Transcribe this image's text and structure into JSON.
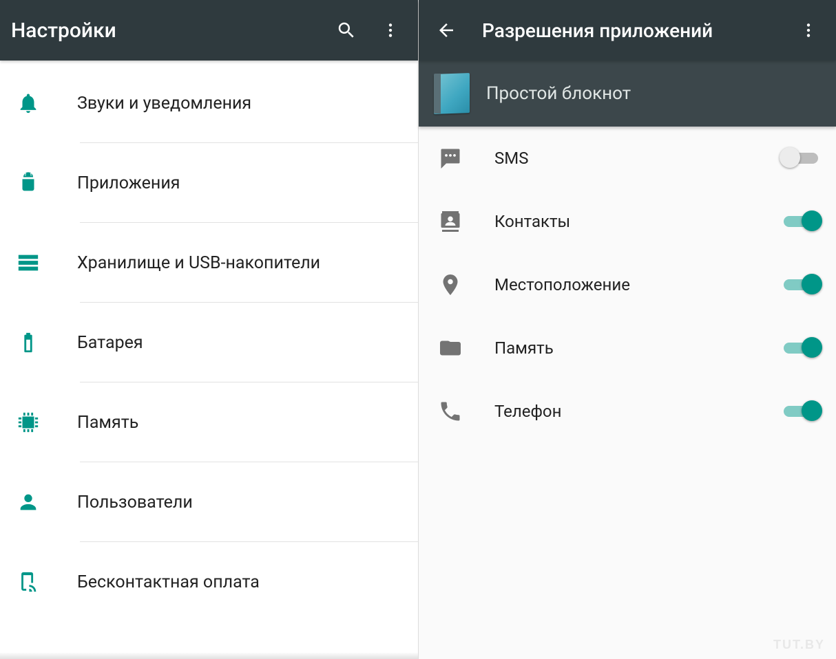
{
  "left": {
    "title": "Настройки",
    "items": [
      {
        "icon": "bell",
        "label": "Звуки и уведомления"
      },
      {
        "icon": "android",
        "label": "Приложения"
      },
      {
        "icon": "storage",
        "label": "Хранилище и USB-накопители"
      },
      {
        "icon": "battery",
        "label": "Батарея"
      },
      {
        "icon": "memory",
        "label": "Память"
      },
      {
        "icon": "user",
        "label": "Пользователи"
      },
      {
        "icon": "nfc",
        "label": "Бесконтактная оплата"
      }
    ]
  },
  "right": {
    "title": "Разрешения приложений",
    "app_name": "Простой блокнот",
    "permissions": [
      {
        "icon": "sms",
        "label": "SMS",
        "enabled": false
      },
      {
        "icon": "contacts",
        "label": "Контакты",
        "enabled": true
      },
      {
        "icon": "location",
        "label": "Местоположение",
        "enabled": true
      },
      {
        "icon": "folder",
        "label": "Память",
        "enabled": true
      },
      {
        "icon": "phone",
        "label": "Телефон",
        "enabled": true
      }
    ]
  },
  "watermark": "TUT.BY",
  "colors": {
    "accent": "#009688",
    "appbar": "#2f3a3e",
    "subbar": "#3c474b",
    "perm_icon": "#737373"
  }
}
